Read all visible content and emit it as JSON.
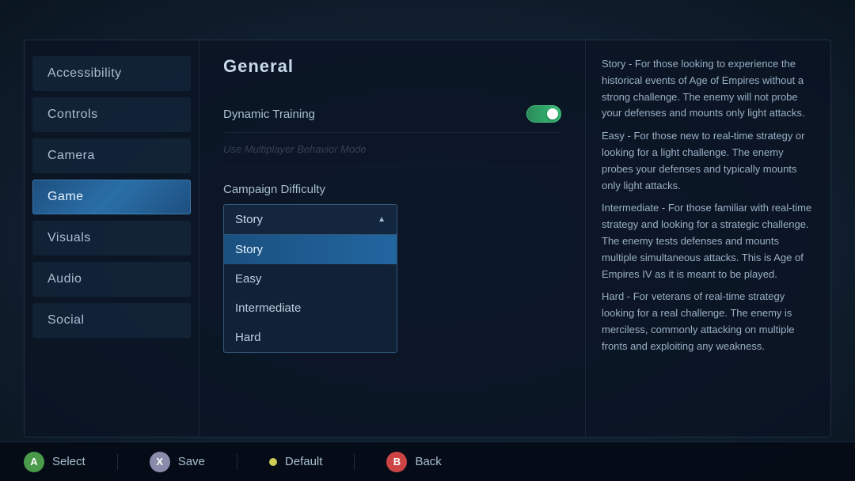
{
  "sidebar": {
    "items": [
      {
        "id": "accessibility",
        "label": "Accessibility",
        "active": false
      },
      {
        "id": "controls",
        "label": "Controls",
        "active": false
      },
      {
        "id": "camera",
        "label": "Camera",
        "active": false
      },
      {
        "id": "game",
        "label": "Game",
        "active": true
      },
      {
        "id": "visuals",
        "label": "Visuals",
        "active": false
      },
      {
        "id": "audio",
        "label": "Audio",
        "active": false
      },
      {
        "id": "social",
        "label": "Social",
        "active": false
      }
    ]
  },
  "content": {
    "title": "General",
    "settings": [
      {
        "id": "dynamic-training",
        "label": "Dynamic Training",
        "toggle": true,
        "enabled": true
      },
      {
        "id": "multiplayer-behavior",
        "label": "Use Multiplayer Behavior Mode",
        "toggle": false,
        "enabled": false,
        "disabled": true
      }
    ],
    "campaign_difficulty": {
      "label": "Campaign Difficulty",
      "selected": "Story",
      "options": [
        "Story",
        "Easy",
        "Intermediate",
        "Hard"
      ]
    }
  },
  "descriptions": {
    "story": "Story - For those looking to experience the historical events of Age of Empires without a strong challenge. The enemy will not probe your defenses and mounts only light attacks.",
    "easy": "Easy - For those new to real-time strategy or looking for a light challenge. The enemy probes your defenses and typically mounts only light attacks.",
    "intermediate": "Intermediate - For those familiar with real-time strategy and looking for a strategic challenge. The enemy tests defenses and mounts multiple simultaneous attacks. This is Age of Empires IV as it is meant to be played.",
    "hard": "Hard - For veterans of real-time strategy looking for a real challenge. The enemy is merciless, commonly attacking on multiple fronts and exploiting any weakness."
  },
  "bottom_bar": {
    "actions": [
      {
        "id": "select",
        "icon": "A",
        "icon_type": "a",
        "label": "Select"
      },
      {
        "id": "save",
        "icon": "X",
        "icon_type": "x",
        "label": "Save"
      },
      {
        "id": "default",
        "icon": "●",
        "icon_type": "default-btn",
        "label": "Default"
      },
      {
        "id": "back",
        "icon": "B",
        "icon_type": "b",
        "label": "Back"
      }
    ]
  }
}
